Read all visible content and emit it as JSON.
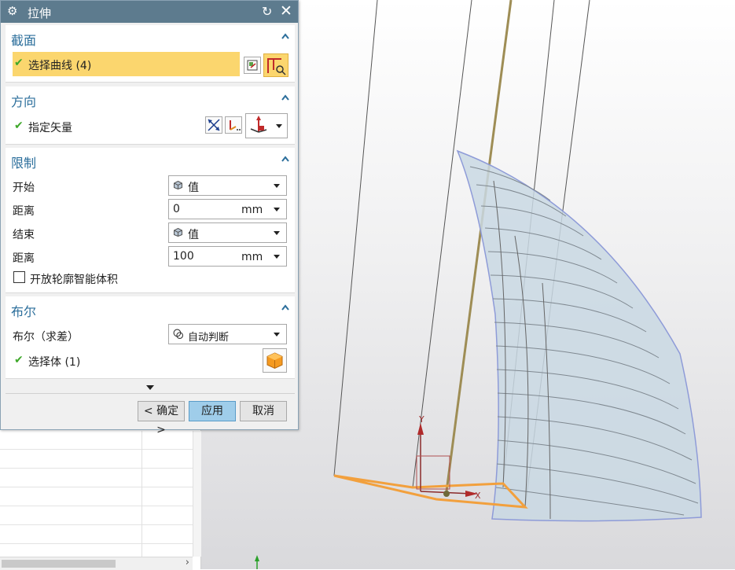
{
  "dialog": {
    "title": "拉伸",
    "title_icon": "gear-icon",
    "reset_icon": "reset-icon",
    "close_icon": "close-icon"
  },
  "section_curve": {
    "title": "截面",
    "select_curve_label": "选择曲线 (4)"
  },
  "section_direction": {
    "title": "方向",
    "specify_vector_label": "指定矢量"
  },
  "section_limits": {
    "title": "限制",
    "start_label": "开始",
    "start_value": "值",
    "start_distance_label": "距离",
    "start_distance_value": "0",
    "start_distance_unit": "mm",
    "end_label": "结束",
    "end_value": "值",
    "end_distance_label": "距离",
    "end_distance_value": "100",
    "end_distance_unit": "mm",
    "open_profile_label": "开放轮廓智能体积"
  },
  "section_boolean": {
    "title": "布尔",
    "boolean_label": "布尔（求差）",
    "boolean_value": "自动判断",
    "select_body_label": "选择体 (1)"
  },
  "buttons": {
    "ok": "< 确定 >",
    "apply": "应用",
    "cancel": "取消"
  },
  "viewport": {
    "axis_x": "X",
    "axis_y": "Y",
    "highlight_color": "#f2a03d",
    "surface_color": "#c9d8e3",
    "edge_color": "#8e9bd8"
  },
  "colors": {
    "titlebar": "#5d7b8e",
    "section_title": "#2b6e9b",
    "selection_highlight": "#fbd66e",
    "apply_button": "#9fcdea",
    "check": "#3fa82a"
  }
}
